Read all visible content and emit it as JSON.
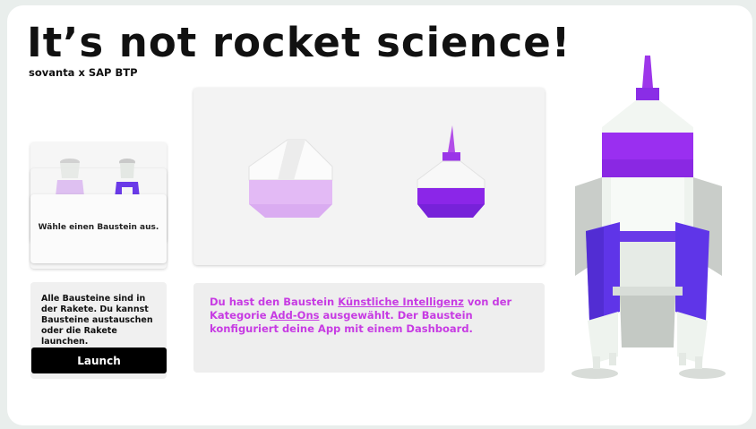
{
  "header": {
    "title": "It’s not rocket science!",
    "subtitle": "sovanta x SAP BTP"
  },
  "selector": {
    "prompt": "Wähle einen Baustein aus."
  },
  "status": {
    "message": "Alle Bausteine sind in der Rakete. Du kannst Bausteine austauschen oder die Rakete launchen.",
    "launch_label": "Launch"
  },
  "description": {
    "prefix": "Du hast den Baustein ",
    "module": "Künstliche Intelligenz",
    "middle": " von der Kategorie ",
    "category": "Add-Ons",
    "suffix": " ausgewählt. Der Baustein konfiguriert deine App mit einem Dashboard."
  },
  "colors": {
    "accent": "#c73be3",
    "rocket_purple": "#8c2df0",
    "rocket_violet": "#5f35e8",
    "rocket_white": "#eef3ee"
  }
}
